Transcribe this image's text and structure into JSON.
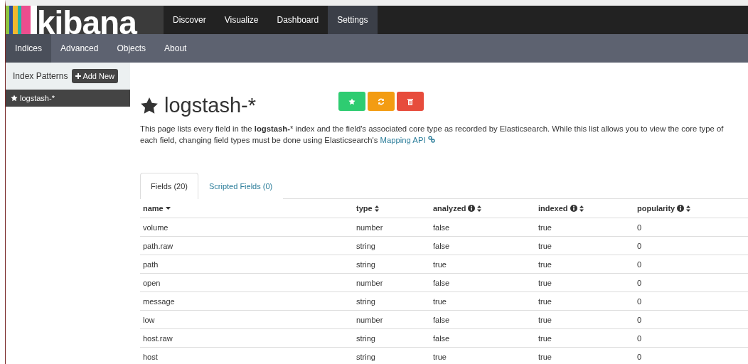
{
  "logo": {
    "text": "kibana"
  },
  "nav": [
    {
      "label": "Discover",
      "selected": false
    },
    {
      "label": "Visualize",
      "selected": false
    },
    {
      "label": "Dashboard",
      "selected": false
    },
    {
      "label": "Settings",
      "selected": true
    }
  ],
  "subnav": [
    {
      "label": "Indices",
      "selected": true
    },
    {
      "label": "Advanced",
      "selected": false
    },
    {
      "label": "Objects",
      "selected": false
    },
    {
      "label": "About",
      "selected": false
    }
  ],
  "sidebar": {
    "title": "Index Patterns",
    "add_button": "Add New",
    "items": [
      {
        "label": "logstash-*",
        "selected": true
      }
    ]
  },
  "index": {
    "title": "logstash-*",
    "actions": [
      {
        "kind": "default",
        "color": "#2ecc71"
      },
      {
        "kind": "refresh",
        "color": "#f39c12"
      },
      {
        "kind": "delete",
        "color": "#e74c3c"
      }
    ],
    "description": "This page lists every field in the **logstash-*** index and the field's associated core type as recorded by Elasticsearch. While this list allows you to view the core type of each field, changing field types must be done using Elasticsearch's",
    "link": "Mapping API"
  },
  "tabs": [
    {
      "label": "Fields (20)",
      "selected": true
    },
    {
      "label": "Scripted Fields (0)",
      "selected": false
    }
  ],
  "table": {
    "columns": [
      {
        "label": "name",
        "kind": "sorted",
        "info": false
      },
      {
        "label": "type",
        "kind": "sortable",
        "info": false
      },
      {
        "label": "analyzed",
        "kind": "sortable",
        "info": true
      },
      {
        "label": "indexed",
        "kind": "sortable",
        "info": true
      },
      {
        "label": "popularity",
        "kind": "sortable",
        "info": true
      }
    ],
    "rows": [
      [
        "volume",
        "number",
        "false",
        "true",
        "0"
      ],
      [
        "path.raw",
        "string",
        "false",
        "true",
        "0"
      ],
      [
        "path",
        "string",
        "true",
        "true",
        "0"
      ],
      [
        "open",
        "number",
        "false",
        "true",
        "0"
      ],
      [
        "message",
        "string",
        "true",
        "true",
        "0"
      ],
      [
        "low",
        "number",
        "false",
        "true",
        "0"
      ],
      [
        "host.raw",
        "string",
        "false",
        "true",
        "0"
      ],
      [
        "host",
        "string",
        "true",
        "true",
        "0"
      ]
    ]
  }
}
